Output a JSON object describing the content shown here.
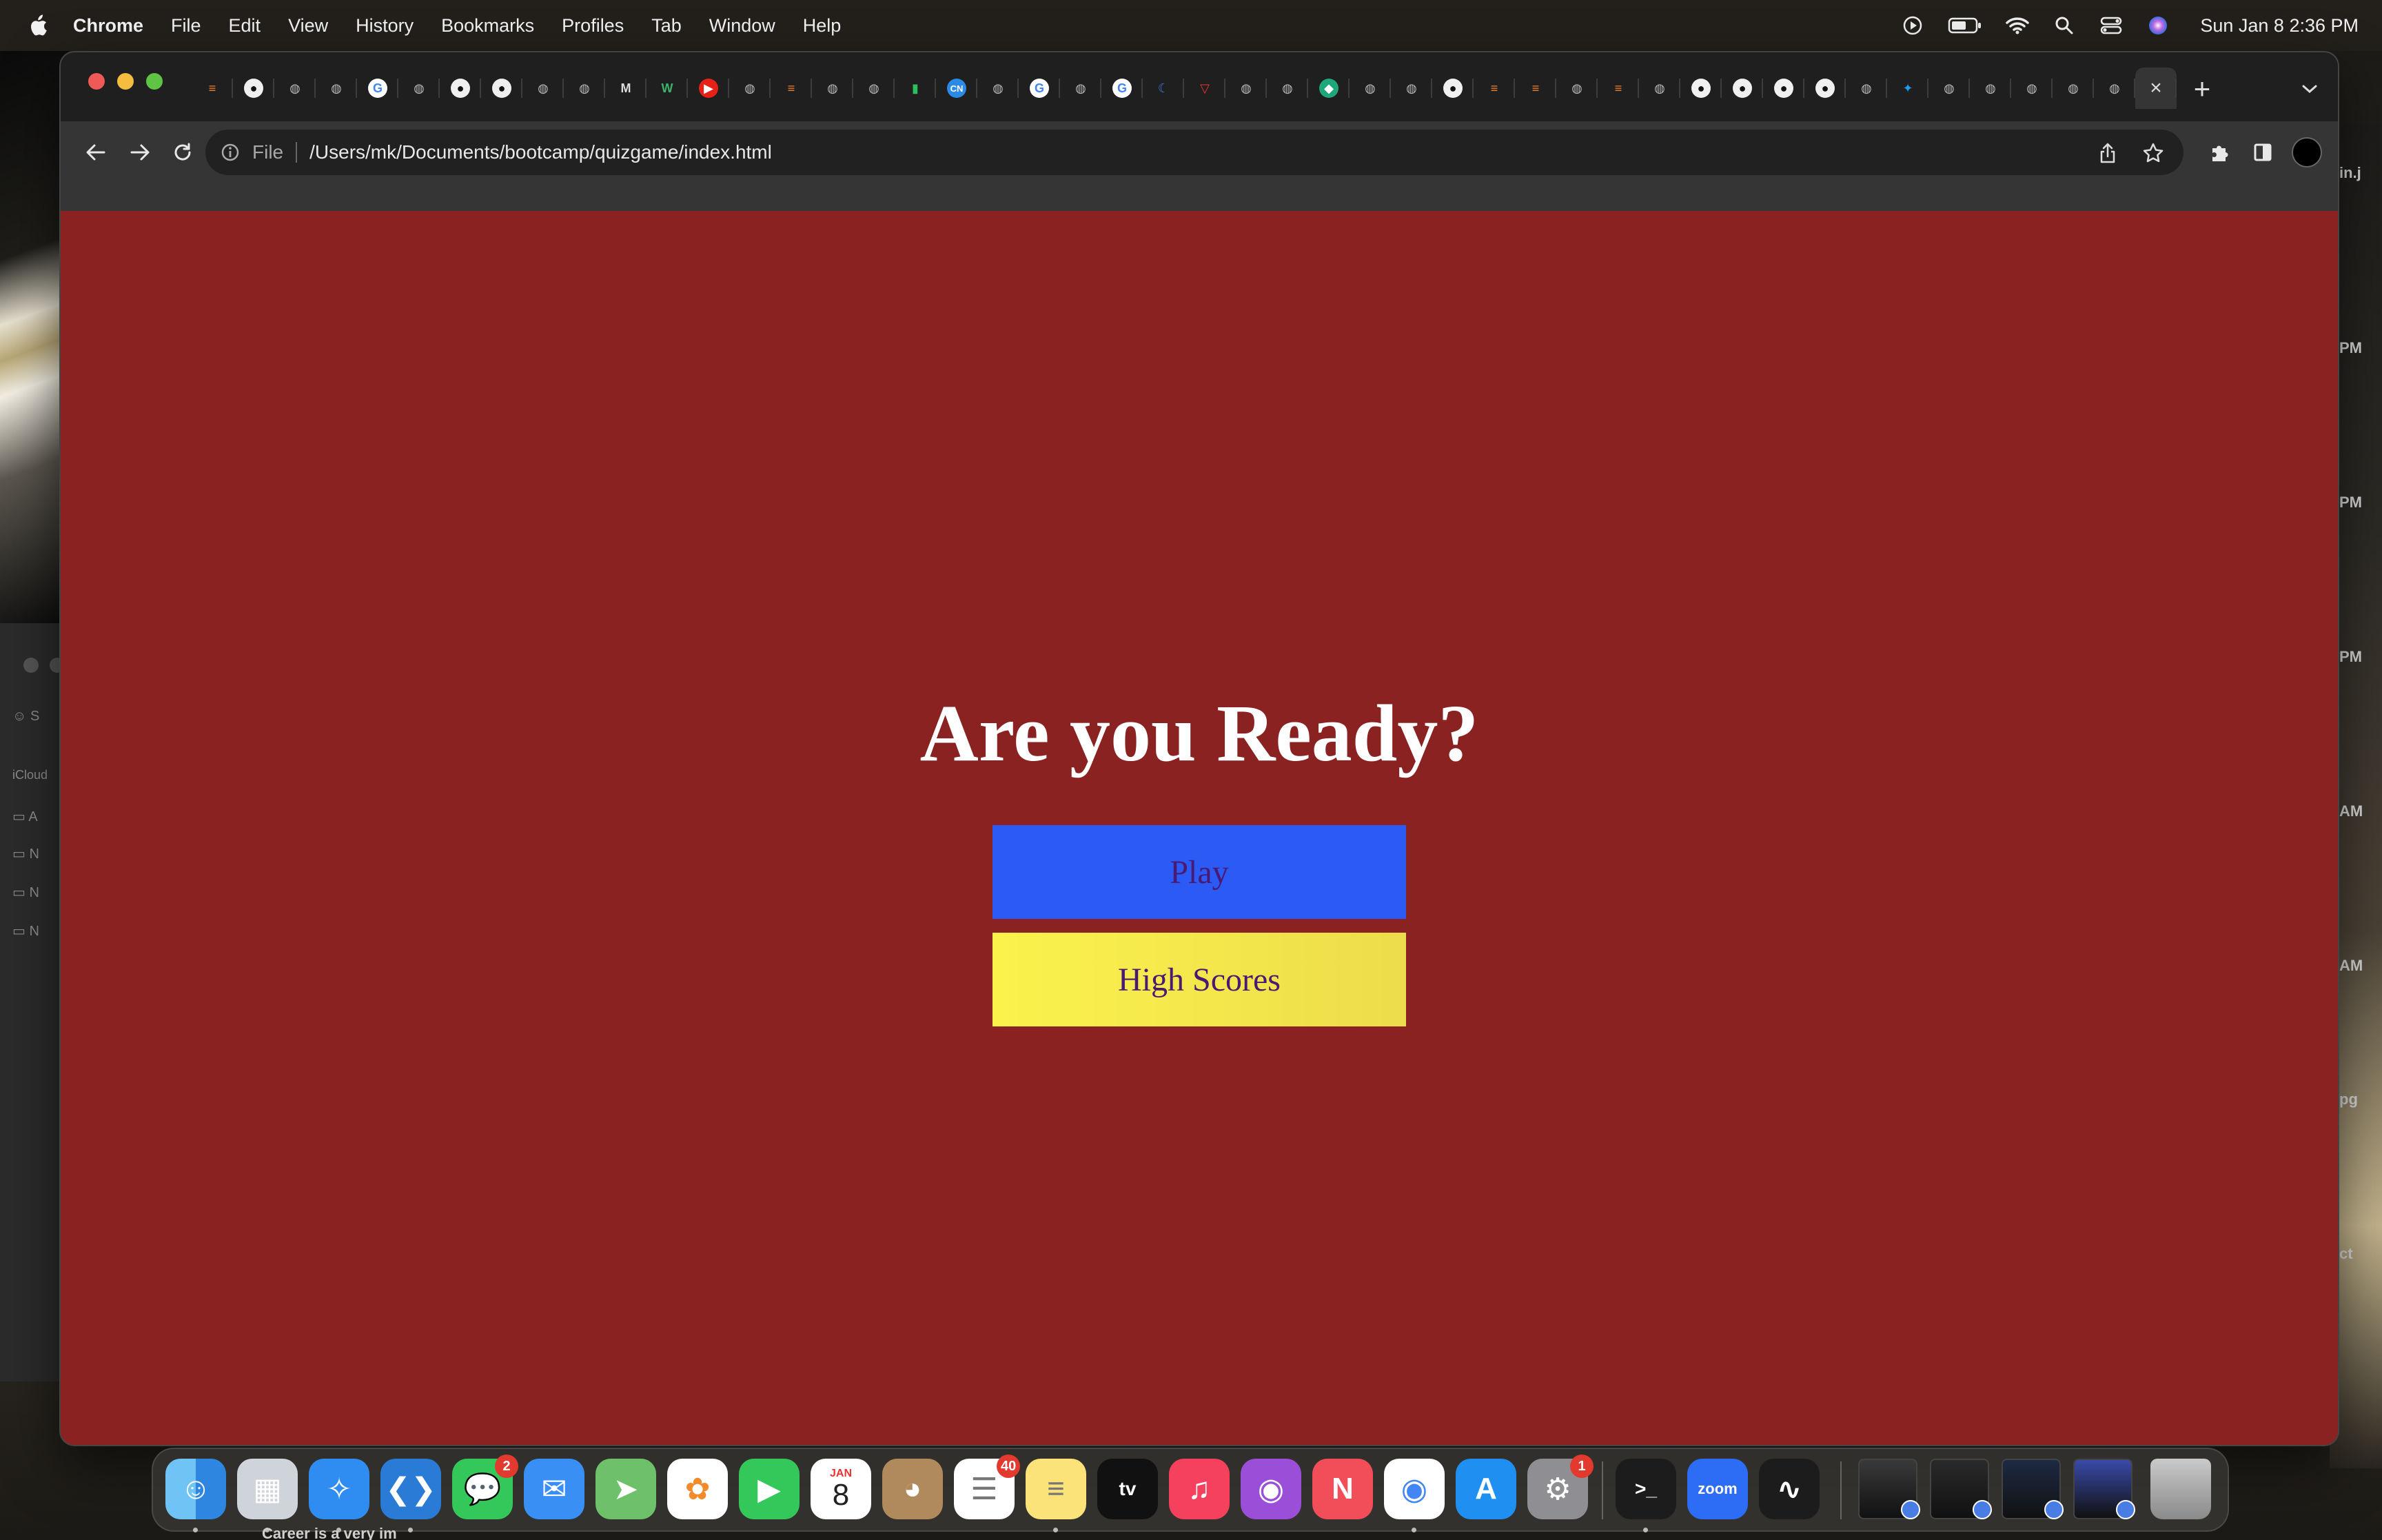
{
  "menubar": {
    "app_name": "Chrome",
    "items": [
      "File",
      "Edit",
      "View",
      "History",
      "Bookmarks",
      "Profiles",
      "Tab",
      "Window",
      "Help"
    ],
    "clock": "Sun Jan 8  2:36 PM",
    "icons": [
      "play-circle-icon",
      "battery-icon",
      "wifi-icon",
      "spotlight-search-icon",
      "control-center-icon",
      "siri-icon"
    ]
  },
  "background": {
    "finder_sidebar": {
      "section": "iCloud",
      "rows": [
        "A",
        "N",
        "N",
        "N"
      ]
    },
    "right_edge_text": [
      "in.j",
      "PM",
      "PM",
      "PM",
      "AM",
      "AM",
      "pg",
      "ct"
    ],
    "bottom_text": "Career is a very im"
  },
  "browser": {
    "tab_favicons": [
      "stackoverflow",
      "github",
      "globe",
      "globe",
      "google",
      "globe",
      "github",
      "github",
      "globe",
      "globe",
      "medium",
      "webflow",
      "youtube",
      "globe",
      "stackoverflow",
      "globe",
      "globe",
      "evernote",
      "cn",
      "globe",
      "google",
      "globe",
      "google",
      "wave",
      "vercel",
      "globe",
      "globe",
      "codepen",
      "globe",
      "globe",
      "github",
      "stackoverflow",
      "stackoverflow",
      "globe",
      "stackoverflow",
      "globe",
      "github",
      "github",
      "github",
      "github",
      "globe",
      "twitter",
      "globe",
      "globe",
      "globe",
      "globe",
      "globe"
    ],
    "close_tab_label": "×",
    "new_tab_label": "+",
    "address_bar": {
      "scheme_label": "File",
      "url": "/Users/mk/Documents/bootcamp/quizgame/index.html"
    }
  },
  "page": {
    "heading": "Are you Ready?",
    "play_label": "Play",
    "high_scores_label": "High Scores",
    "colors": {
      "background": "#8a2221",
      "play": "#2b5af5",
      "high_scores": "#fbf24c",
      "button_text": "#4a1a73"
    }
  },
  "dock": {
    "apps": [
      {
        "name": "finder"
      },
      {
        "name": "launchpad"
      },
      {
        "name": "safari"
      },
      {
        "name": "vscode"
      },
      {
        "name": "messages",
        "badge": "2"
      },
      {
        "name": "mail"
      },
      {
        "name": "maps"
      },
      {
        "name": "photos"
      },
      {
        "name": "facetime"
      },
      {
        "name": "calendar",
        "month": "JAN",
        "day": "8"
      },
      {
        "name": "contacts"
      },
      {
        "name": "reminders",
        "badge": "40"
      },
      {
        "name": "notes"
      },
      {
        "name": "apple-tv",
        "label": "tv"
      },
      {
        "name": "music"
      },
      {
        "name": "podcasts"
      },
      {
        "name": "news"
      },
      {
        "name": "chrome"
      },
      {
        "name": "app-store"
      },
      {
        "name": "system-settings",
        "badge": "1"
      },
      {
        "name": "terminal",
        "label": ">_"
      },
      {
        "name": "zoom",
        "label": "zoom"
      },
      {
        "name": "activity-monitor"
      }
    ]
  }
}
